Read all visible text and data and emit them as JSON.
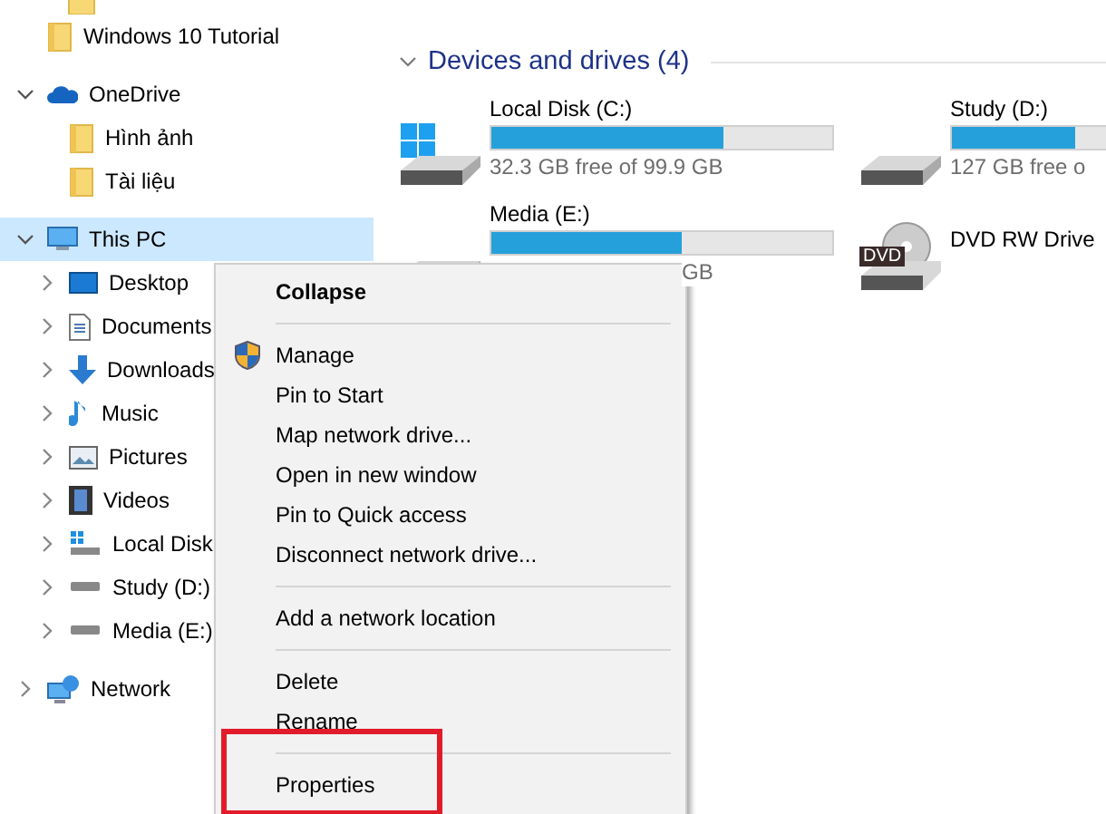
{
  "nav": {
    "items": [
      {
        "label": "Windows 10 Tutorial"
      },
      {
        "label": "OneDrive",
        "expanded": true,
        "selected": false,
        "children": [
          {
            "label": "Hình ảnh"
          },
          {
            "label": "Tài liệu"
          }
        ]
      },
      {
        "label": "This PC",
        "expanded": true,
        "selected": true,
        "children": [
          {
            "label": "Desktop",
            "expanded": false
          },
          {
            "label": "Documents",
            "expanded": false
          },
          {
            "label": "Downloads",
            "expanded": false
          },
          {
            "label": "Music",
            "expanded": false
          },
          {
            "label": "Pictures",
            "expanded": false
          },
          {
            "label": "Videos",
            "expanded": false
          },
          {
            "label": "Local Disk",
            "expanded": false
          },
          {
            "label": "Study (D:)",
            "expanded": false
          },
          {
            "label": "Media (E:)",
            "expanded": false
          }
        ]
      },
      {
        "label": "Network",
        "expanded": false,
        "selected": false
      }
    ]
  },
  "section": {
    "title": "Devices and drives (4)",
    "expanded": true
  },
  "drives": [
    {
      "kind": "disk",
      "name": "Local Disk (C:)",
      "level": 0.68,
      "caption": "32.3 GB free of 99.9 GB"
    },
    {
      "kind": "disk",
      "name": "Study (D:)",
      "level": 0.36,
      "caption": "127 GB free o"
    },
    {
      "kind": "disk",
      "name": "Media (E:)",
      "level": 0.56,
      "caption": "GB"
    },
    {
      "kind": "dvd",
      "name": "DVD RW Drive",
      "badge": "DVD"
    }
  ],
  "context_menu": {
    "items": [
      {
        "kind": "item",
        "label": "Collapse",
        "bold": true
      },
      {
        "kind": "separator"
      },
      {
        "kind": "item",
        "label": "Manage",
        "shield": true
      },
      {
        "kind": "item",
        "label": "Pin to Start"
      },
      {
        "kind": "item",
        "label": "Map network drive..."
      },
      {
        "kind": "item",
        "label": "Open in new window"
      },
      {
        "kind": "item",
        "label": "Pin to Quick access"
      },
      {
        "kind": "item",
        "label": "Disconnect network drive..."
      },
      {
        "kind": "separator"
      },
      {
        "kind": "item",
        "label": "Add a network location"
      },
      {
        "kind": "separator"
      },
      {
        "kind": "item",
        "label": "Delete"
      },
      {
        "kind": "item",
        "label": "Rename"
      },
      {
        "kind": "separator"
      },
      {
        "kind": "item",
        "label": "Properties",
        "highlighted": true
      }
    ]
  }
}
